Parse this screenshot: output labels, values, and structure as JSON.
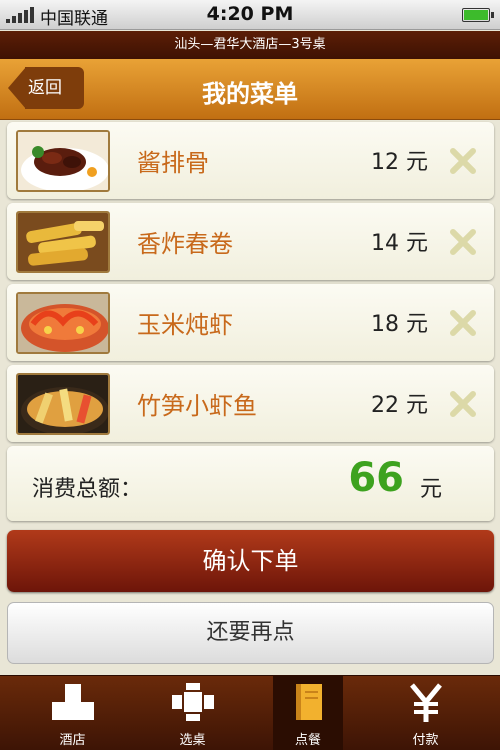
{
  "status_bar": {
    "carrier": "中国联通",
    "time": "4:20 PM"
  },
  "location": "汕头—君华大酒店—3号桌",
  "nav": {
    "back_label": "返回",
    "title": "我的菜单"
  },
  "dishes": [
    {
      "name": "酱排骨",
      "price": "12 元"
    },
    {
      "name": "香炸春卷",
      "price": "14 元"
    },
    {
      "name": "玉米炖虾",
      "price": "18 元"
    },
    {
      "name": "竹笋小虾鱼",
      "price": "22 元"
    }
  ],
  "total": {
    "label": "消费总额：",
    "value": "66",
    "unit": "元"
  },
  "buttons": {
    "confirm": "确认下单",
    "more": "还要再点"
  },
  "tabs": [
    {
      "label": "酒店",
      "icon": "hotel-icon"
    },
    {
      "label": "选桌",
      "icon": "table-icon"
    },
    {
      "label": "点餐",
      "icon": "menu-book-icon"
    },
    {
      "label": "付款",
      "icon": "yuan-icon"
    }
  ],
  "active_tab": 2,
  "colors": {
    "dish_name": "#c8691b",
    "total": "#3da21f",
    "accent": "#c16f12",
    "confirm": "#8f2512"
  }
}
